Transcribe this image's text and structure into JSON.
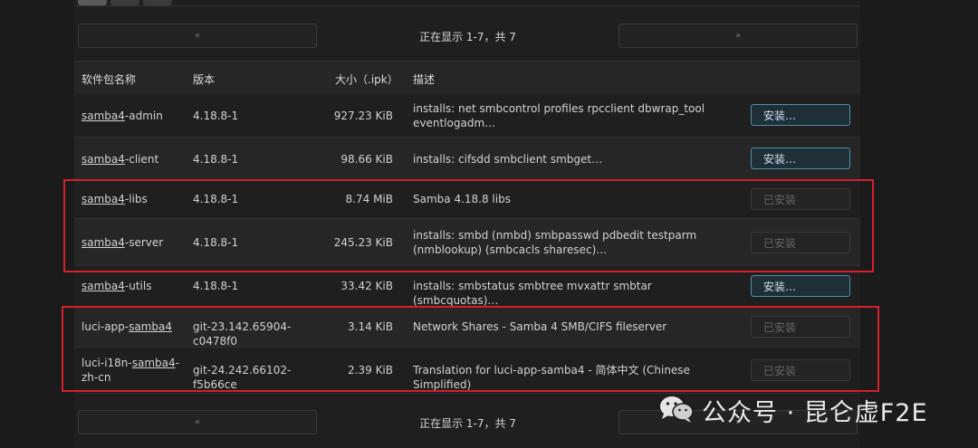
{
  "pagination": {
    "prev_label": "«",
    "next_label": "»",
    "status_text": "正在显示 1-7，共 7"
  },
  "table": {
    "headers": {
      "name": "软件包名称",
      "version": "版本",
      "size": "大小（.ipk）",
      "description": "描述"
    },
    "rows": [
      {
        "name_link": "samba4",
        "name_suffix": "-admin",
        "version": "4.18.8-1",
        "size": "927.23 KiB",
        "description": "installs: net smbcontrol profiles rpcclient dbwrap_tool eventlogadm…",
        "action": "安装…",
        "status": "install"
      },
      {
        "name_link": "samba4",
        "name_suffix": "-client",
        "version": "4.18.8-1",
        "size": "98.66 KiB",
        "description": "installs: cifsdd smbclient smbget…",
        "action": "安装…",
        "status": "install"
      },
      {
        "name_link": "samba4",
        "name_suffix": "-libs",
        "version": "4.18.8-1",
        "size": "8.74 MiB",
        "description": "Samba 4.18.8 libs",
        "action": "已安装",
        "status": "installed"
      },
      {
        "name_link": "samba4",
        "name_suffix": "-server",
        "version": "4.18.8-1",
        "size": "245.23 KiB",
        "description": "installs: smbd (nmbd) smbpasswd pdbedit testparm (nmblookup) (smbcacls sharesec)…",
        "action": "已安装",
        "status": "installed"
      },
      {
        "name_link": "samba4",
        "name_suffix": "-utils",
        "version": "4.18.8-1",
        "size": "33.42 KiB",
        "description": "installs: smbstatus smbtree mvxattr smbtar (smbcquotas)…",
        "action": "安装…",
        "status": "install"
      },
      {
        "name_prefix": "luci-app-",
        "name_link": "samba4",
        "version": "git-23.142.65904-c0478f0",
        "size": "3.14 KiB",
        "description": "Network Shares - Samba 4 SMB/CIFS fileserver",
        "action": "已安装",
        "status": "installed"
      },
      {
        "name_prefix": "luci-i18n-",
        "name_link": "samba4",
        "name_suffix": "-",
        "name_line2": "zh-cn",
        "version": "git-24.242.66102-f5b66ce",
        "size": "2.39 KiB",
        "description_prefix": "Translation for luci-app-",
        "description_link": "samba4",
        "description_suffix": " - 简体中文 (Chinese Simplified)",
        "action": "已安装",
        "status": "installed"
      }
    ]
  },
  "watermark": {
    "text": "公众号 · 昆仑虚F2E",
    "icon": "wechat-icon"
  },
  "colors": {
    "highlight_border": "#d4202a",
    "install_button_border": "#4f8fa8"
  }
}
